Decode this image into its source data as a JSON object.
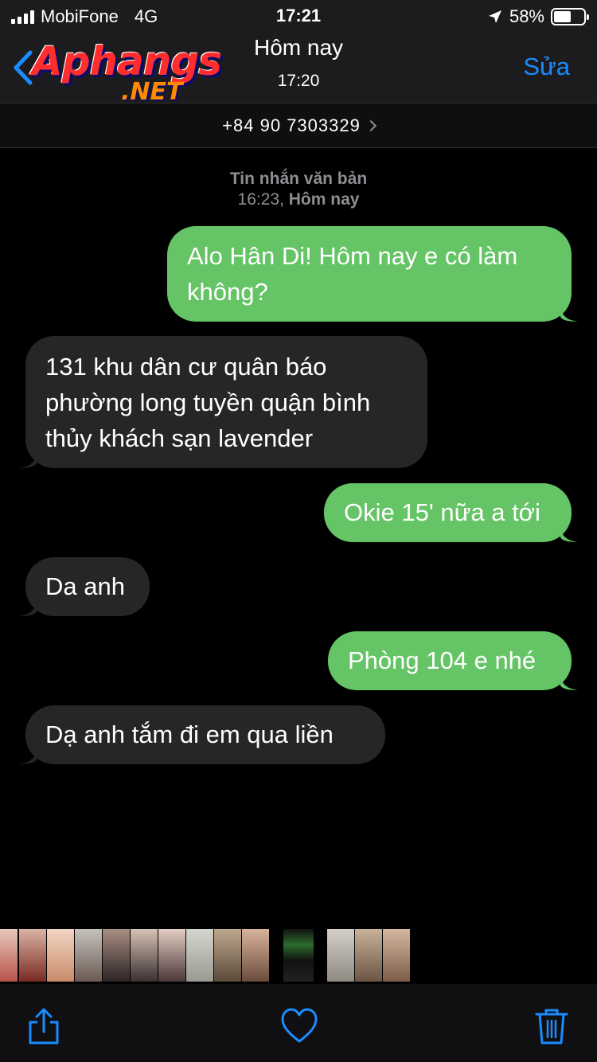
{
  "status": {
    "carrier": "MobiFone",
    "network": "4G",
    "time": "17:21",
    "battery": "58%",
    "battery_level": 0.58
  },
  "header": {
    "logo_main": "Aphangs",
    "logo_sub": ".NET",
    "title": "Hôm nay",
    "subtitle": "17:20",
    "edit_label": "Sửa",
    "phone": "+84 90 7303329"
  },
  "thread": {
    "kind_label": "Tin nhắn văn bản",
    "time_label": "16:23,",
    "day_label": "Hôm nay",
    "messages": [
      {
        "direction": "sent",
        "text": "Alo Hân Di! Hôm nay e có làm không?"
      },
      {
        "direction": "received",
        "text": "131 khu dân cư quân báo phường long tuyền quận bình thủy khách sạn lavender"
      },
      {
        "direction": "sent",
        "text": "Okie 15' nữa a tới"
      },
      {
        "direction": "received",
        "text": "Da anh"
      },
      {
        "direction": "sent",
        "text": "Phòng 104 e nhé"
      },
      {
        "direction": "received",
        "text": "Dạ anh tắm đi em qua liền"
      }
    ]
  },
  "toolbar": {
    "share_icon": "share-icon",
    "like_icon": "heart-icon",
    "delete_icon": "trash-icon"
  },
  "colors": {
    "sent_bubble": "#65c466",
    "received_bubble": "#262628",
    "accent": "#1a8cff",
    "background": "#000000"
  }
}
